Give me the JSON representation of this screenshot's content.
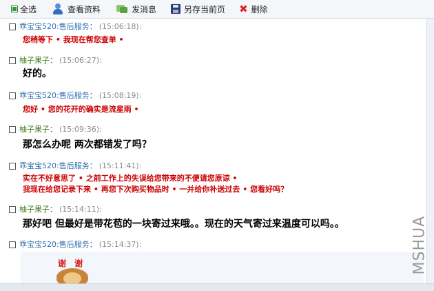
{
  "toolbar": {
    "select_all_label": "全选",
    "view_profile_label": "查看资料",
    "send_message_label": "发消息",
    "save_page_label": "另存当前页",
    "delete_label": "删除"
  },
  "messages": [
    {
      "sender": "乖宝宝520:售后服务：",
      "time": "(15:06:18):",
      "lines": [
        "您稍等下 • 我现在帮您查单 •"
      ]
    },
    {
      "sender": "柚子果子：",
      "time": "(15:06:27):",
      "lines": [
        "好的。"
      ]
    },
    {
      "sender": "乖宝宝520:售后服务：",
      "time": "(15:08:19):",
      "lines": [
        "您好 • 您的花开的确实是流星雨 •"
      ]
    },
    {
      "sender": "柚子果子：",
      "time": "(15:09:36):",
      "lines": [
        "那怎么办呢  两次都错发了吗？"
      ]
    },
    {
      "sender": "乖宝宝520:售后服务：",
      "time": "(15:11:41):",
      "lines": [
        "实在不好意思了 • 之前工作上的失误给您带来的不便请您原谅 •",
        "我现在给您记录下来 • 再您下次购买物品时 • 一并给你补送过去 • 您看好吗？"
      ]
    },
    {
      "sender": "柚子果子：",
      "time": "(15:14:11):",
      "lines": [
        "那好吧  但最好是带花苞的一块寄过来哦。。现在的天气寄过来温度可以吗。。"
      ]
    },
    {
      "sender": "乖宝宝520:售后服务：",
      "time": "(15:14:37):",
      "lines": []
    }
  ],
  "sticker": {
    "text": "谢 谢"
  },
  "watermark": "MSHUA",
  "colors": {
    "service_sender": "#2e6fb0",
    "customer_sender": "#3c7a1a",
    "service_text": "#cc0000",
    "customer_text": "#000000",
    "timestamp": "#8a8a8a"
  },
  "icons": {
    "view_profile": "person-icon",
    "send_message": "message-icon",
    "save_page": "save-icon",
    "delete": "delete-x-icon"
  }
}
